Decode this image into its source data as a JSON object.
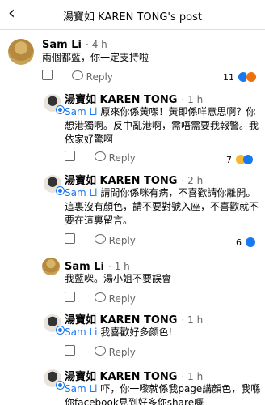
{
  "header": {
    "back_icon": "‹",
    "title": "湯寶如 KAREN TONG's post"
  },
  "comments": [
    {
      "name": "Sam Li",
      "time": "4 h",
      "text": "兩個都藍，你一定支持啦",
      "reply": "Reply",
      "count": "11"
    },
    {
      "name": "湯寶如 KAREN TONG",
      "time": "1 h",
      "mention": "Sam Li",
      "text": "原來你係黃㗎！黃即係咩意思啊？你想港獨啊。反中亂港啊，需唔需要我報警。我依家好驚啊",
      "reply": "Reply",
      "count": "7"
    },
    {
      "name": "湯寶如 KAREN TONG",
      "time": "2 h",
      "mention": "Sam Li",
      "text": "請問你係咪有病，不喜歡請你離開。這裏沒有顏色，請不要對號入座，不喜歡就不要在這裏留言。",
      "reply": "Reply",
      "count": "6"
    },
    {
      "name": "Sam Li",
      "time": "1 h",
      "text": "我藍㗎。湯小姐不要誤會",
      "reply": "Reply",
      "count": ""
    },
    {
      "name": "湯寶如 KAREN TONG",
      "time": "1 h",
      "mention": "Sam Li",
      "text": "我喜歡好多颜色!",
      "reply": "Reply",
      "count": ""
    },
    {
      "name": "湯寶如 KAREN TONG",
      "time": "1 h",
      "mention": "Sam Li",
      "text": "吓，你一嚟就係我page講顏色，我喺你facebook見到好多你share嘅",
      "reply": "",
      "count": ""
    }
  ]
}
